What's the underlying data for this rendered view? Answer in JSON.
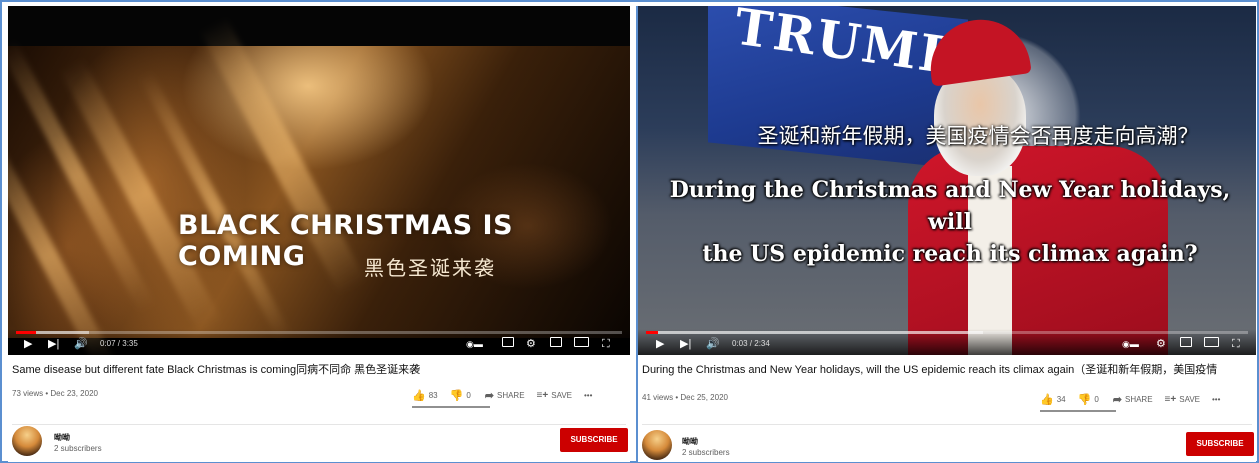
{
  "left": {
    "overlay_title": "BLACK CHRISTMAS IS COMING",
    "overlay_subtitle": "黑色圣诞来袭",
    "time": "0:07 / 3:35",
    "progress": 0.033,
    "video_title": "Same disease but different fate Black Christmas is coming同病不同命 黑色圣诞来袭",
    "meta": "73 views • Dec 23, 2020",
    "likes": "83",
    "dislikes": "0",
    "share_label": "SHARE",
    "save_label": "SAVE",
    "more_label": "•••",
    "channel_name": "呦呦",
    "subscribers": "2 subscribers",
    "subscribe_label": "SUBSCRIBE"
  },
  "right": {
    "flag_text": "TRUMP",
    "subtitle_cn": "圣诞和新年假期，美国疫情会否再度走向高潮？",
    "subtitle_en_line1": "During the Christmas and New Year holidays, will",
    "subtitle_en_line2": "the US epidemic reach its climax again?",
    "time": "0:03 / 2:34",
    "progress": 0.02,
    "video_title": "During the Christmas and New Year holidays, will the US epidemic reach its climax again（圣诞和新年假期，美国疫情",
    "meta": "41 views • Dec 25, 2020",
    "likes": "34",
    "dislikes": "0",
    "share_label": "SHARE",
    "save_label": "SAVE",
    "more_label": "•••",
    "channel_name": "呦呦",
    "subscribers": "2 subscribers",
    "subscribe_label": "SUBSCRIBE"
  },
  "icons": {
    "play": "play-icon",
    "next": "next-icon",
    "volume": "volume-icon",
    "autoplay": "autoplay-toggle",
    "captions": "captions-icon",
    "settings": "settings-icon",
    "miniplayer": "miniplayer-icon",
    "theater": "theater-icon",
    "fullscreen": "fullscreen-icon",
    "like": "thumbs-up-icon",
    "dislike": "thumbs-down-icon",
    "share": "share-icon",
    "save": "save-playlist-icon"
  },
  "colors": {
    "subscribe": "#cc0000",
    "progress": "#ff0000",
    "frame_border": "#5b8fd0"
  }
}
